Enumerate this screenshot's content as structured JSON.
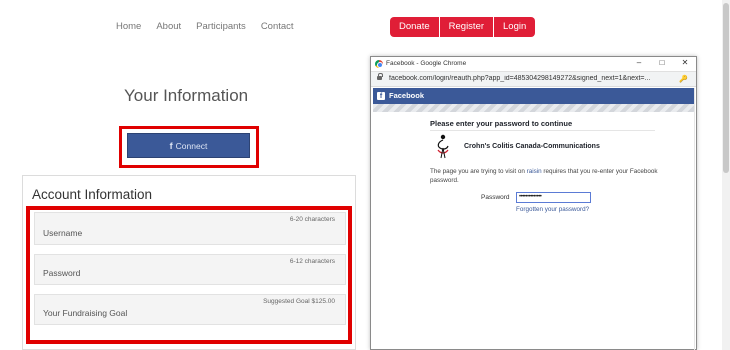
{
  "nav": {
    "links": [
      "Home",
      "About",
      "Participants",
      "Contact"
    ],
    "buttons": [
      "Donate",
      "Register",
      "Login"
    ]
  },
  "main": {
    "title": "Your Information",
    "connect_label": "Connect",
    "connect_icon": "f"
  },
  "account": {
    "title": "Account Information",
    "fields": [
      {
        "label": "Username",
        "hint": "6-20 characters"
      },
      {
        "label": "Password",
        "hint": "6-12 characters"
      },
      {
        "label": "Your Fundraising Goal",
        "hint": "Suggested Goal $125.00"
      }
    ]
  },
  "popup": {
    "window_title": "Facebook - Google Chrome",
    "url": "facebook.com/login/reauth.php?app_id=485304298149272&signed_next=1&next=...",
    "header": "Facebook",
    "heading": "Please enter your password to continue",
    "app_name": "Crohn's Colitis Canada-Communications",
    "desc_before": "The page you are trying to visit on ",
    "desc_link": "raisin",
    "desc_after": " requires that you re-enter your Facebook password.",
    "password_label": "Password",
    "password_value": "••••••••••••••",
    "forgot_link": "Forgotten your password?"
  },
  "colors": {
    "accent_red": "#e01e37",
    "highlight_frame": "#e00000",
    "facebook_blue": "#3b5998"
  }
}
